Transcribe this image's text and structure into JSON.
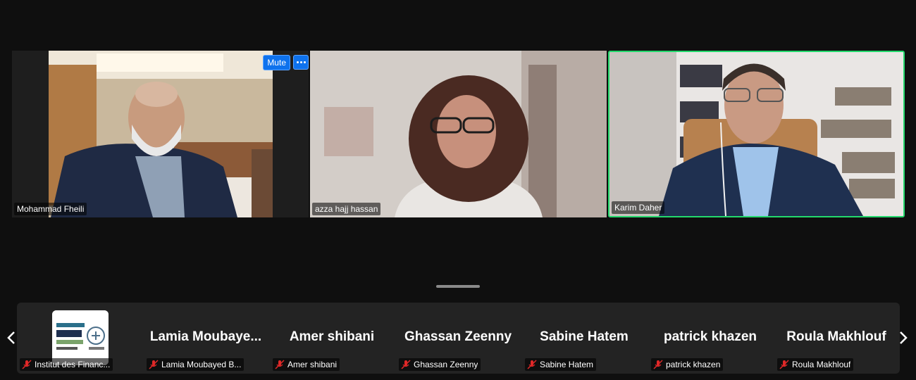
{
  "speakers": [
    {
      "name": "Mohammad Fheili",
      "active": false
    },
    {
      "name": "azza hajj hassan",
      "active": false
    },
    {
      "name": "Karim Daher",
      "active": true
    }
  ],
  "hover_controls": {
    "mute_label": "Mute",
    "more_icon": "ellipsis-icon"
  },
  "accent_color": "#23d96c",
  "button_color": "#0e72ed",
  "gallery": [
    {
      "display": "",
      "tag": "Institut des Financ...",
      "type": "logo"
    },
    {
      "display": "Lamia  Moubaye...",
      "tag": "Lamia Moubayed B...",
      "type": "name"
    },
    {
      "display": "Amer shibani",
      "tag": "Amer shibani",
      "type": "name"
    },
    {
      "display": "Ghassan Zeenny",
      "tag": "Ghassan Zeenny",
      "type": "name"
    },
    {
      "display": "Sabine Hatem",
      "tag": "Sabine Hatem",
      "type": "name"
    },
    {
      "display": "patrick khazen",
      "tag": "patrick khazen",
      "type": "name"
    },
    {
      "display": "Roula Makhlouf",
      "tag": "Roula Makhlouf",
      "type": "name"
    }
  ]
}
